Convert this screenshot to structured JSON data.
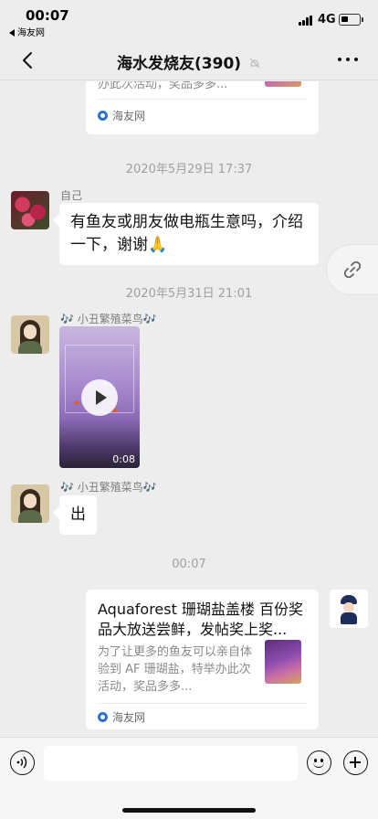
{
  "status_bar": {
    "time": "00:07",
    "back_app": "海友网",
    "network": "4G"
  },
  "nav": {
    "title": "海水发烧友(390)",
    "icons": [
      "back-arrow-icon",
      "mute-bell-icon",
      "more-dots-icon"
    ]
  },
  "messages": {
    "top_card": {
      "desc_partial": "办此次活动，奖品多多...",
      "source": "海友网"
    },
    "timestamp_1": "2020年5月29日 17:37",
    "msg_self": {
      "sender": "自己",
      "text": "有鱼友或朋友做电瓶生意吗，介绍一下，谢谢🙏"
    },
    "timestamp_2": "2020年5月31日 21:01",
    "msg_video": {
      "sender": "🎶 小丑繁殖菜鸟🎶",
      "duration": "0:08"
    },
    "msg_chu": {
      "sender": "🎶 小丑繁殖菜鸟🎶",
      "text": "出"
    },
    "timestamp_3": "00:07",
    "bottom_card": {
      "title": "Aquaforest 珊瑚盐盖楼 百份奖品大放送尝鲜，发帖奖上奖...",
      "desc": "为了让更多的鱼友可以亲自体验到 AF 珊瑚盐，特举办此次活动，奖品多多...",
      "source": "海友网"
    }
  },
  "input_bar": {
    "placeholder": "",
    "icons": [
      "voice-icon",
      "emoji-icon",
      "plus-icon"
    ]
  },
  "colors": {
    "background": "#ededed",
    "bubble": "#ffffff",
    "timestamp": "#a0a0a0"
  }
}
